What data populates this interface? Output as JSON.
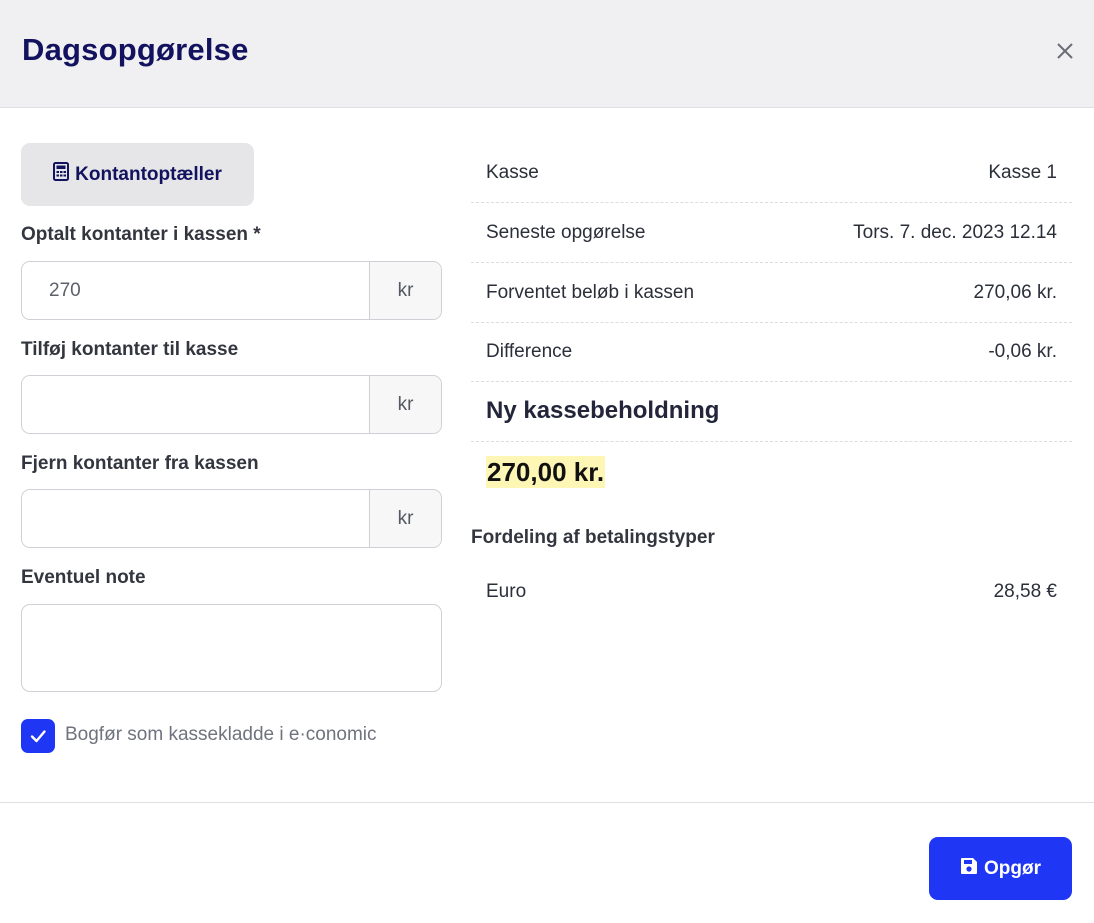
{
  "header": {
    "title": "Dagsopgørelse",
    "close_icon": "close-icon"
  },
  "left": {
    "counter_button": {
      "label": "Kontantoptæller",
      "icon": "calculator-icon"
    },
    "counted": {
      "label": "Optalt kontanter i kassen *",
      "value": "270",
      "unit": "kr"
    },
    "add_cash": {
      "label": "Tilføj kontanter til kasse",
      "value": "",
      "unit": "kr"
    },
    "remove_cash": {
      "label": "Fjern kontanter fra kassen",
      "value": "",
      "unit": "kr"
    },
    "note": {
      "label": "Eventuel note",
      "value": ""
    },
    "book_checkbox": {
      "label": "Bogfør som kassekladde i e·conomic",
      "checked": true
    }
  },
  "summary": {
    "rows": [
      {
        "label": "Kasse",
        "value": "Kasse 1"
      },
      {
        "label": "Seneste opgørelse",
        "value": "Tors. 7. dec. 2023 12.14"
      },
      {
        "label": "Forventet beløb i kassen",
        "value": "270,06 kr."
      },
      {
        "label": "Difference",
        "value": "-0,06 kr."
      }
    ],
    "new_balance_title": "Ny kassebeholdning",
    "new_balance_value": "270,00 kr.",
    "payment_title": "Fordeling af betalingstyper",
    "payments": [
      {
        "label": "Euro",
        "value": "28,58 €"
      }
    ]
  },
  "footer": {
    "submit_label": "Opgør",
    "submit_icon": "save-icon"
  },
  "colors": {
    "primary": "#1f36f5",
    "title": "#12125e",
    "highlight": "#fdf6b4",
    "header_bg": "#f0f0f2"
  }
}
